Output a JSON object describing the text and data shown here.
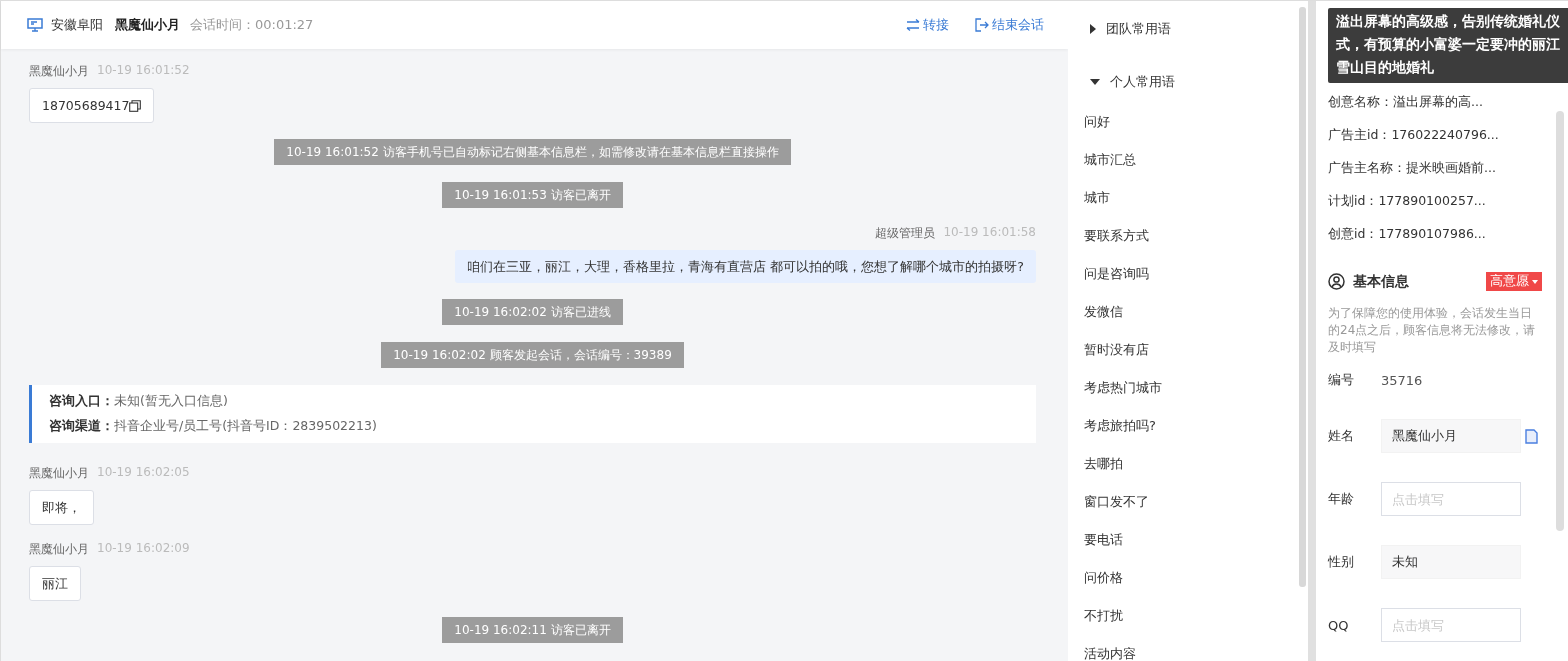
{
  "header": {
    "location": "安徽阜阳",
    "visitor": "黑魔仙小月",
    "duration_label": "会话时间：",
    "duration": "00:01:27",
    "actions": [
      {
        "kind": "transfer",
        "label": "转接"
      },
      {
        "kind": "end",
        "label": "结束会话"
      }
    ]
  },
  "messages": [
    {
      "kind": "visitor",
      "name": "黑魔仙小月",
      "time": "10-19 16:01:52",
      "text": "18705689417",
      "copyable": true
    },
    {
      "kind": "system",
      "text": "10-19 16:01:52 访客手机号已自动标记右侧基本信息栏，如需修改请在基本信息栏直接操作"
    },
    {
      "kind": "system",
      "text": "10-19 16:01:53 访客已离开"
    },
    {
      "kind": "agent",
      "name": "超级管理员",
      "time": "10-19 16:01:58",
      "text": "咱们在三亚，丽江，大理，香格里拉，青海有直营店 都可以拍的哦，您想了解哪个城市的拍摄呀?"
    },
    {
      "kind": "system",
      "text": "10-19 16:02:02 访客已进线"
    },
    {
      "kind": "system",
      "text": "10-19 16:02:02 顾客发起会话，会话编号：39389"
    },
    {
      "kind": "info",
      "lines": [
        {
          "label": "咨询入口：",
          "value": "未知(暂无入口信息)"
        },
        {
          "label": "咨询渠道：",
          "value": "抖音企业号/员工号(抖音号ID：2839502213)"
        }
      ]
    },
    {
      "kind": "visitor",
      "name": "黑魔仙小月",
      "time": "10-19 16:02:05",
      "text": "即将，",
      "copyable": false
    },
    {
      "kind": "visitor",
      "name": "黑魔仙小月",
      "time": "10-19 16:02:09",
      "text": "丽江",
      "copyable": false
    },
    {
      "kind": "system",
      "text": "10-19 16:02:11 访客已离开"
    }
  ],
  "phrases": [
    {
      "label": "团队常用语",
      "expanded": false
    },
    {
      "label": "个人常用语",
      "expanded": true,
      "children": [
        "问好",
        "城市汇总",
        "城市",
        "要联系方式",
        "问是咨询吗",
        "发微信",
        "暂时没有店",
        "考虑热门城市",
        "考虑旅拍吗?",
        "去哪拍",
        "窗口发不了",
        "要电话",
        "问价格",
        "不打扰",
        "活动内容"
      ]
    }
  ],
  "ad_info": {
    "tooltip": "溢出屏幕的高级感，告别传统婚礼仪式，有预算的小富婆一定要冲的丽江雪山目的地婚礼",
    "rows": [
      "创意名称：溢出屏幕的高...",
      "广告主id：176022240796...",
      "广告主名称：提米映画婚前...",
      "计划id：177890100257...",
      "创意id：177890107986..."
    ]
  },
  "basic_info": {
    "title": "基本信息",
    "tag": "高意愿",
    "note": "为了保障您的使用体验，会话发生当日的24点之后，顾客信息将无法修改，请及时填写",
    "number_label": "编号",
    "number": "35716",
    "fields": [
      {
        "label": "姓名",
        "value": "黑魔仙小月",
        "readonly": true
      },
      {
        "label": "年龄",
        "placeholder": "点击填写",
        "readonly": false
      },
      {
        "label": "性别",
        "value": "未知",
        "readonly": true
      },
      {
        "label": "QQ",
        "placeholder": "点击填写",
        "readonly": false
      }
    ]
  }
}
